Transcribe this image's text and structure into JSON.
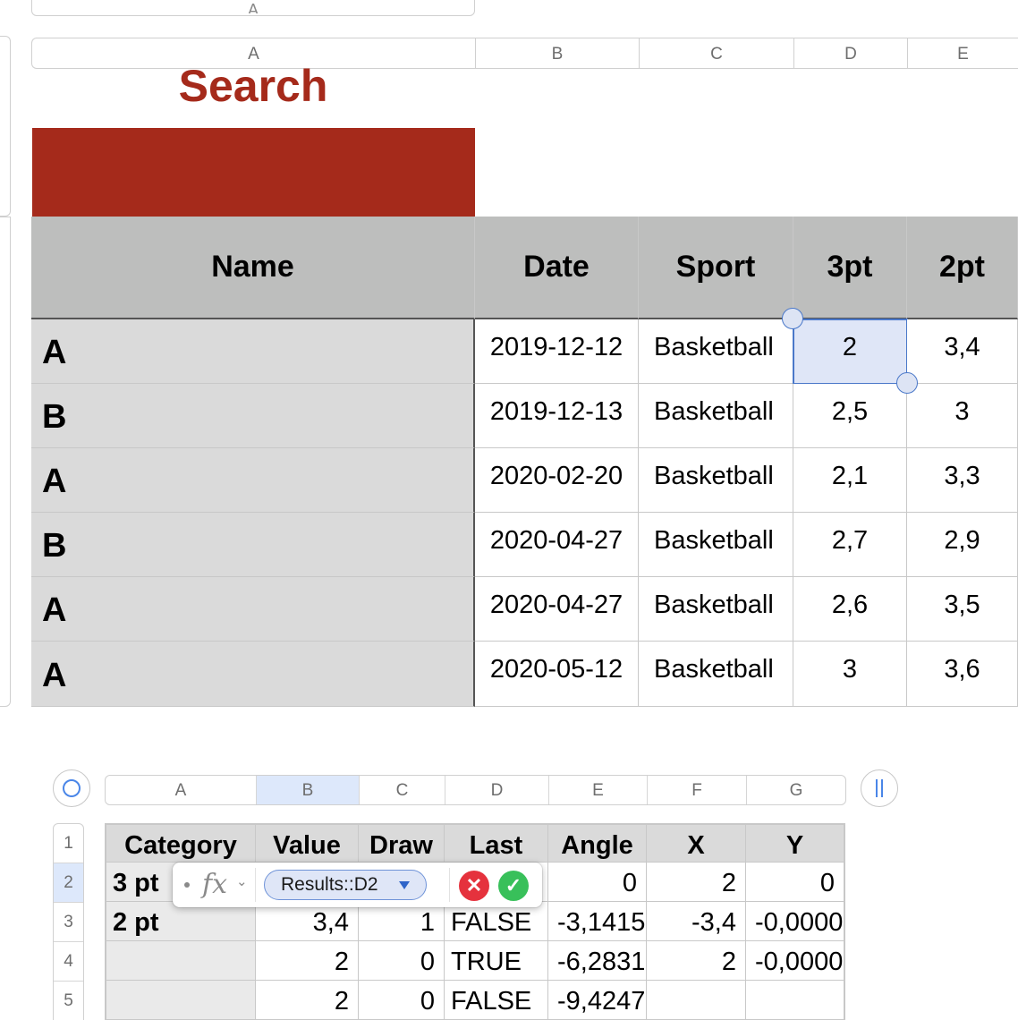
{
  "top_table": {
    "partial_header": "A"
  },
  "table1": {
    "column_headers": [
      "A",
      "B",
      "C",
      "D",
      "E"
    ],
    "title": "Search",
    "headers": {
      "name": "Name",
      "date": "Date",
      "sport": "Sport",
      "three_pt": "3pt",
      "two_pt": "2pt"
    },
    "rows": [
      {
        "name": "A",
        "date": "2019-12-12",
        "sport": "Basketball",
        "three_pt": "2",
        "two_pt": "3,4"
      },
      {
        "name": "B",
        "date": "2019-12-13",
        "sport": "Basketball",
        "three_pt": "2,5",
        "two_pt": "3"
      },
      {
        "name": "A",
        "date": "2020-02-20",
        "sport": "Basketball",
        "three_pt": "2,1",
        "two_pt": "3,3"
      },
      {
        "name": "B",
        "date": "2020-04-27",
        "sport": "Basketball",
        "three_pt": "2,7",
        "two_pt": "2,9"
      },
      {
        "name": "A",
        "date": "2020-04-27",
        "sport": "Basketball",
        "three_pt": "2,6",
        "two_pt": "3,5"
      },
      {
        "name": "A",
        "date": "2020-05-12",
        "sport": "Basketball",
        "three_pt": "3",
        "two_pt": "3,6"
      }
    ],
    "colors": {
      "title": "#a52a1b",
      "banner": "#a52a1b",
      "header_bg": "#bdbebd",
      "name_bg": "#dadada",
      "selection": "#dfe6f7"
    }
  },
  "table2": {
    "column_headers": [
      "A",
      "B",
      "C",
      "D",
      "E",
      "F",
      "G"
    ],
    "row_headers": [
      "1",
      "2",
      "3",
      "4",
      "5"
    ],
    "headers": [
      "Category",
      "Value",
      "Draw",
      "Last",
      "Angle",
      "X",
      "Y"
    ],
    "rows": [
      [
        "3 pt",
        "",
        "",
        "",
        "0",
        "2",
        "0"
      ],
      [
        "2 pt",
        "3,4",
        "1",
        "FALSE",
        "-3,1415",
        "-3,4",
        "-0,0000"
      ],
      [
        "",
        "2",
        "0",
        "TRUE",
        "-6,2831",
        "2",
        "-0,0000"
      ],
      [
        "",
        "2",
        "0",
        "FALSE",
        "-9,4247",
        "",
        ""
      ]
    ]
  },
  "formula_editor": {
    "fx_label": "fx",
    "chevron": "⌄",
    "token": "Results::D2",
    "cancel_symbol": "✕",
    "accept_symbol": "✓"
  }
}
